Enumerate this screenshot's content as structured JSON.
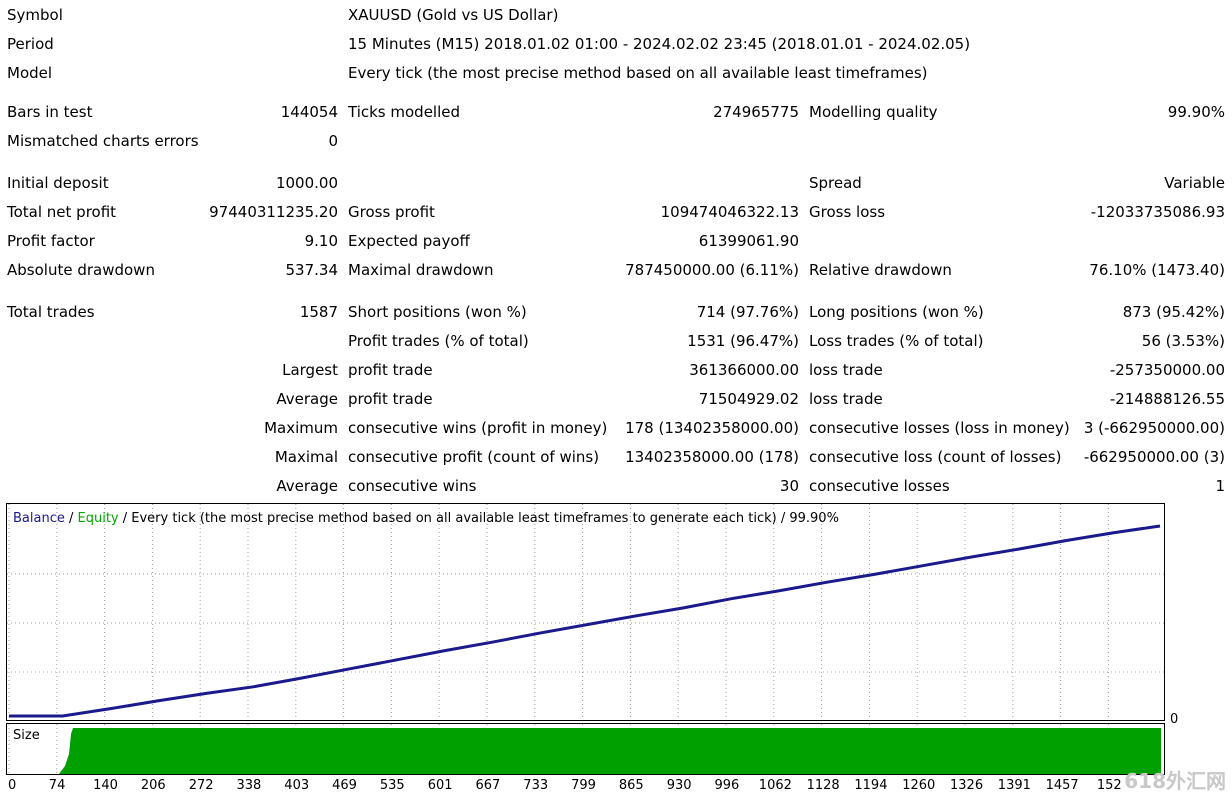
{
  "report": {
    "rows": [
      {
        "id": "symbol",
        "label": "Symbol",
        "value": "XAUUSD (Gold vs US Dollar)"
      },
      {
        "id": "period",
        "label": "Period",
        "value": "15 Minutes (M15) 2018.01.02 01:00 - 2024.02.02 23:45 (2018.01.01 - 2024.02.05)"
      },
      {
        "id": "model",
        "label": "Model",
        "value": "Every tick (the most precise method based on all available least timeframes)"
      }
    ],
    "bars_in_test": {
      "label": "Bars in test",
      "value": "144054"
    },
    "ticks_modelled": {
      "label": "Ticks modelled",
      "value": "274965775"
    },
    "modelling_quality": {
      "label": "Modelling quality",
      "value": "99.90%"
    },
    "mismatched": {
      "label": "Mismatched charts errors",
      "value": "0"
    },
    "initial_deposit": {
      "label": "Initial deposit",
      "value": "1000.00"
    },
    "spread": {
      "label": "Spread",
      "value": "Variable"
    },
    "total_net_profit": {
      "label": "Total net profit",
      "value": "97440311235.20"
    },
    "gross_profit": {
      "label": "Gross profit",
      "value": "109474046322.13"
    },
    "gross_loss": {
      "label": "Gross loss",
      "value": "-12033735086.93"
    },
    "profit_factor": {
      "label": "Profit factor",
      "value": "9.10"
    },
    "expected_payoff": {
      "label": "Expected payoff",
      "value": "61399061.90"
    },
    "absolute_drawdown": {
      "label": "Absolute drawdown",
      "value": "537.34"
    },
    "maximal_drawdown": {
      "label": "Maximal drawdown",
      "value": "787450000.00 (6.11%)"
    },
    "relative_drawdown": {
      "label": "Relative drawdown",
      "value": "76.10% (1473.40)"
    },
    "total_trades": {
      "label": "Total trades",
      "value": "1587"
    },
    "short_positions": {
      "label": "Short positions (won %)",
      "value": "714 (97.76%)"
    },
    "long_positions": {
      "label": "Long positions (won %)",
      "value": "873 (95.42%)"
    },
    "profit_trades": {
      "label": "Profit trades (% of total)",
      "value": "1531 (96.47%)"
    },
    "loss_trades": {
      "label": "Loss trades (% of total)",
      "value": "56 (3.53%)"
    },
    "largest": {
      "prefix": "Largest",
      "p_label": "profit trade",
      "p_value": "361366000.00",
      "l_label": "loss trade",
      "l_value": "-257350000.00"
    },
    "average": {
      "prefix": "Average",
      "p_label": "profit trade",
      "p_value": "71504929.02",
      "l_label": "loss trade",
      "l_value": "-214888126.55"
    },
    "maximum": {
      "prefix": "Maximum",
      "p_label": "consecutive wins (profit in money)",
      "p_value": "178 (13402358000.00)",
      "l_label": "consecutive losses (loss in money)",
      "l_value": "3 (-662950000.00)"
    },
    "maximal": {
      "prefix": "Maximal",
      "p_label": "consecutive profit (count of wins)",
      "p_value": "13402358000.00 (178)",
      "l_label": "consecutive loss (count of losses)",
      "l_value": "-662950000.00 (3)"
    },
    "average2": {
      "prefix": "Average",
      "p_label": "consecutive wins",
      "p_value": "30",
      "l_label": "consecutive losses",
      "l_value": "1"
    }
  },
  "chart": {
    "legend_balance": "Balance",
    "legend_sep1": " / ",
    "legend_equity": "Equity",
    "legend_rest": " / Every tick (the most precise method based on all available least timeframes to generate each tick) / 99.90%",
    "size_label": "Size",
    "zero_label": "0",
    "colors": {
      "balance": "#1a1a8c",
      "equity": "#00aa00",
      "size": "#00a000",
      "grid": "#a0a0a0"
    }
  },
  "chart_data": {
    "type": "line",
    "series": [
      {
        "name": "Balance",
        "x": [
          0,
          74,
          140,
          206,
          272,
          338,
          403,
          469,
          535,
          601,
          667,
          733,
          799,
          865,
          930,
          996,
          1062,
          1128,
          1194,
          1260,
          1326,
          1391,
          1457,
          1523,
          1587
        ],
        "values": [
          0,
          0,
          0.012,
          0.025,
          0.037,
          0.048,
          0.062,
          0.077,
          0.092,
          0.107,
          0.121,
          0.136,
          0.15,
          0.164,
          0.177,
          0.192,
          0.205,
          0.219,
          0.232,
          0.246,
          0.26,
          0.273,
          0.287,
          0.3,
          0.311
        ]
      }
    ],
    "x_ticks": [
      "0",
      "74",
      "140",
      "206",
      "272",
      "338",
      "403",
      "469",
      "535",
      "601",
      "667",
      "733",
      "799",
      "865",
      "930",
      "996",
      "1062",
      "1128",
      "1194",
      "1260",
      "1326",
      "1391",
      "1457",
      "152"
    ],
    "y_ticks": [
      "0"
    ]
  },
  "watermark": "618外汇网"
}
